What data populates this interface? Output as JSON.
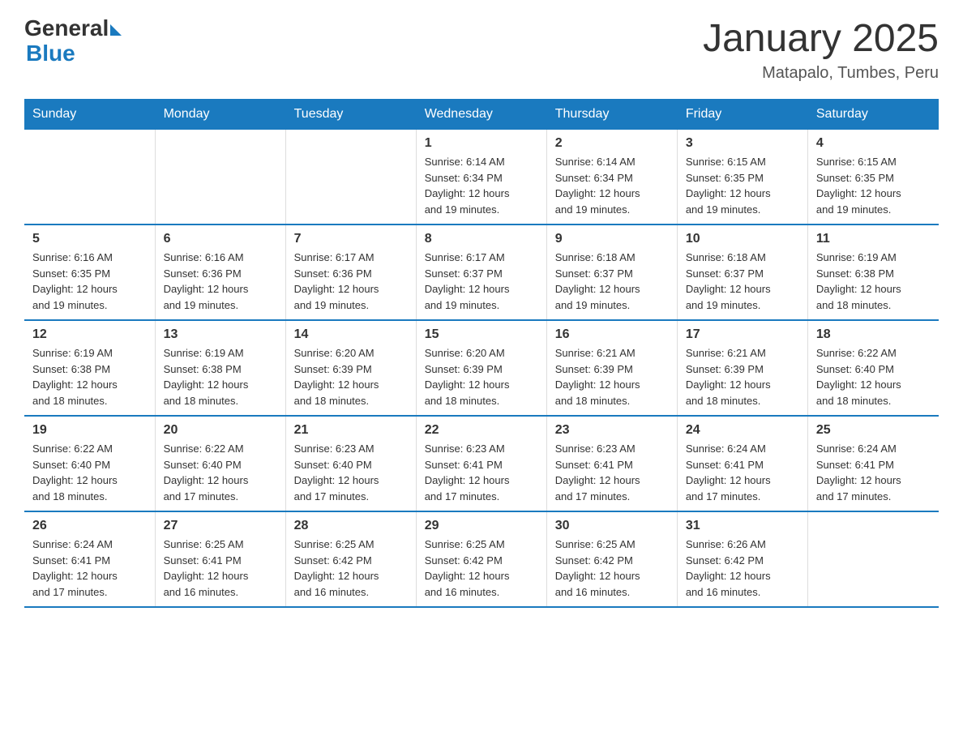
{
  "header": {
    "logo": {
      "general": "General",
      "blue": "Blue"
    },
    "title": "January 2025",
    "subtitle": "Matapalo, Tumbes, Peru"
  },
  "calendar": {
    "headers": [
      "Sunday",
      "Monday",
      "Tuesday",
      "Wednesday",
      "Thursday",
      "Friday",
      "Saturday"
    ],
    "weeks": [
      [
        {
          "day": "",
          "info": ""
        },
        {
          "day": "",
          "info": ""
        },
        {
          "day": "",
          "info": ""
        },
        {
          "day": "1",
          "info": "Sunrise: 6:14 AM\nSunset: 6:34 PM\nDaylight: 12 hours\nand 19 minutes."
        },
        {
          "day": "2",
          "info": "Sunrise: 6:14 AM\nSunset: 6:34 PM\nDaylight: 12 hours\nand 19 minutes."
        },
        {
          "day": "3",
          "info": "Sunrise: 6:15 AM\nSunset: 6:35 PM\nDaylight: 12 hours\nand 19 minutes."
        },
        {
          "day": "4",
          "info": "Sunrise: 6:15 AM\nSunset: 6:35 PM\nDaylight: 12 hours\nand 19 minutes."
        }
      ],
      [
        {
          "day": "5",
          "info": "Sunrise: 6:16 AM\nSunset: 6:35 PM\nDaylight: 12 hours\nand 19 minutes."
        },
        {
          "day": "6",
          "info": "Sunrise: 6:16 AM\nSunset: 6:36 PM\nDaylight: 12 hours\nand 19 minutes."
        },
        {
          "day": "7",
          "info": "Sunrise: 6:17 AM\nSunset: 6:36 PM\nDaylight: 12 hours\nand 19 minutes."
        },
        {
          "day": "8",
          "info": "Sunrise: 6:17 AM\nSunset: 6:37 PM\nDaylight: 12 hours\nand 19 minutes."
        },
        {
          "day": "9",
          "info": "Sunrise: 6:18 AM\nSunset: 6:37 PM\nDaylight: 12 hours\nand 19 minutes."
        },
        {
          "day": "10",
          "info": "Sunrise: 6:18 AM\nSunset: 6:37 PM\nDaylight: 12 hours\nand 19 minutes."
        },
        {
          "day": "11",
          "info": "Sunrise: 6:19 AM\nSunset: 6:38 PM\nDaylight: 12 hours\nand 18 minutes."
        }
      ],
      [
        {
          "day": "12",
          "info": "Sunrise: 6:19 AM\nSunset: 6:38 PM\nDaylight: 12 hours\nand 18 minutes."
        },
        {
          "day": "13",
          "info": "Sunrise: 6:19 AM\nSunset: 6:38 PM\nDaylight: 12 hours\nand 18 minutes."
        },
        {
          "day": "14",
          "info": "Sunrise: 6:20 AM\nSunset: 6:39 PM\nDaylight: 12 hours\nand 18 minutes."
        },
        {
          "day": "15",
          "info": "Sunrise: 6:20 AM\nSunset: 6:39 PM\nDaylight: 12 hours\nand 18 minutes."
        },
        {
          "day": "16",
          "info": "Sunrise: 6:21 AM\nSunset: 6:39 PM\nDaylight: 12 hours\nand 18 minutes."
        },
        {
          "day": "17",
          "info": "Sunrise: 6:21 AM\nSunset: 6:39 PM\nDaylight: 12 hours\nand 18 minutes."
        },
        {
          "day": "18",
          "info": "Sunrise: 6:22 AM\nSunset: 6:40 PM\nDaylight: 12 hours\nand 18 minutes."
        }
      ],
      [
        {
          "day": "19",
          "info": "Sunrise: 6:22 AM\nSunset: 6:40 PM\nDaylight: 12 hours\nand 18 minutes."
        },
        {
          "day": "20",
          "info": "Sunrise: 6:22 AM\nSunset: 6:40 PM\nDaylight: 12 hours\nand 17 minutes."
        },
        {
          "day": "21",
          "info": "Sunrise: 6:23 AM\nSunset: 6:40 PM\nDaylight: 12 hours\nand 17 minutes."
        },
        {
          "day": "22",
          "info": "Sunrise: 6:23 AM\nSunset: 6:41 PM\nDaylight: 12 hours\nand 17 minutes."
        },
        {
          "day": "23",
          "info": "Sunrise: 6:23 AM\nSunset: 6:41 PM\nDaylight: 12 hours\nand 17 minutes."
        },
        {
          "day": "24",
          "info": "Sunrise: 6:24 AM\nSunset: 6:41 PM\nDaylight: 12 hours\nand 17 minutes."
        },
        {
          "day": "25",
          "info": "Sunrise: 6:24 AM\nSunset: 6:41 PM\nDaylight: 12 hours\nand 17 minutes."
        }
      ],
      [
        {
          "day": "26",
          "info": "Sunrise: 6:24 AM\nSunset: 6:41 PM\nDaylight: 12 hours\nand 17 minutes."
        },
        {
          "day": "27",
          "info": "Sunrise: 6:25 AM\nSunset: 6:41 PM\nDaylight: 12 hours\nand 16 minutes."
        },
        {
          "day": "28",
          "info": "Sunrise: 6:25 AM\nSunset: 6:42 PM\nDaylight: 12 hours\nand 16 minutes."
        },
        {
          "day": "29",
          "info": "Sunrise: 6:25 AM\nSunset: 6:42 PM\nDaylight: 12 hours\nand 16 minutes."
        },
        {
          "day": "30",
          "info": "Sunrise: 6:25 AM\nSunset: 6:42 PM\nDaylight: 12 hours\nand 16 minutes."
        },
        {
          "day": "31",
          "info": "Sunrise: 6:26 AM\nSunset: 6:42 PM\nDaylight: 12 hours\nand 16 minutes."
        },
        {
          "day": "",
          "info": ""
        }
      ]
    ]
  }
}
